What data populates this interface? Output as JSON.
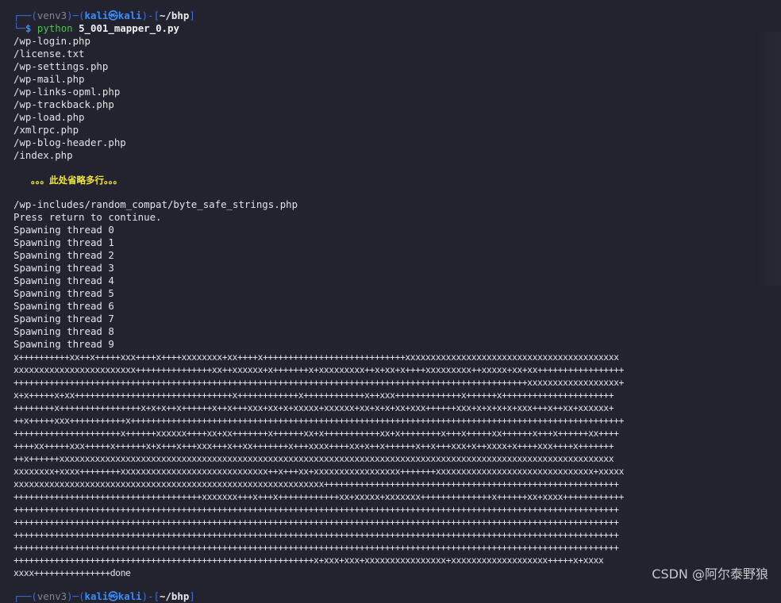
{
  "prompt1": {
    "corner_top": "┌──(",
    "venv": "venv3",
    "mid": ")─(",
    "user": "kali㉿kali",
    "close": ")-[",
    "path": "~/bhp",
    "end": "]",
    "corner_bottom": "└─",
    "dollar": "$",
    "command": "python",
    "arg": "5_001_mapper_0.py"
  },
  "files": [
    "/wp-login.php",
    "/license.txt",
    "/wp-settings.php",
    "/wp-mail.php",
    "/wp-links-opml.php",
    "/wp-trackback.php",
    "/wp-load.php",
    "/xmlrpc.php",
    "/wp-blog-header.php",
    "/index.php"
  ],
  "omitted_note": "。。。此处省略多行。。。",
  "after_lines": [
    "/wp-includes/random_compat/byte_safe_strings.php",
    "Press return to continue.",
    "Spawning thread 0",
    "Spawning thread 1",
    "Spawning thread 2",
    "Spawning thread 3",
    "Spawning thread 4",
    "Spawning thread 5",
    "Spawning thread 6",
    "Spawning thread 7",
    "Spawning thread 8",
    "Spawning thread 9"
  ],
  "progress_lines": [
    "x++++++++++xx++x+++++xxx++++x++++xxxxxxxx+xx++++x++++++++++++++++++++++++++++xxxxxxxxxxxxxxxxxxxxxxxxxxxxxxxxxxxxxxxxxx",
    "xxxxxxxxxxxxxxxxxxxxxxxx+++++++++++++++xx++xxxxxx+x+++++++x+xxxxxxxxx++x+xx+x++++xxxxxxxxx++xxxxx+xx+xx+++++++++++++++++",
    "+++++++++++++++++++++++++++++++++++++++++++++++++++++++++++++++++++++++++++++++++++++++++++++++++++++xxxxxxxxxxxxxxxxxx+",
    "x+x+++++x+xx+++++++++++++++++++++++++++++++x++++++++++++x++++++++++++x++xxx+++++++++++++x++++++x++++++++++++++++++++++",
    "++++++++x++++++++++++++++x+x+x++x++++++x++x+++xxx+xx+x+xxxxx+xxxxxx+xx+x+x+xx+xxx++++++xxx+x+x+x+x+xxx+++x++xx+xxxxxx+",
    "++x+++++xxx+++++++++++x+++++++++++++++++++++++++++++++++++++++++++++++++++++++++++++++++++++++++++++++++++++++++++++++++",
    "+++++++++++++++++++++x++++++xxxxxx++++xx+xx+++++++x++++++xx+x+++++++++++xx+x++++++++x+++x+++++xx++++++x+++x++++++xx++++",
    "++++xx+++++xxx+++++x++++++x+x+++x+++xxx+++x++xx+++++++x+++xxxx++++xx+x++x++++++x++x+++xxx+x++xxxx+x++++xxx++++x+++++++",
    "++x++++++xxxxxxxxxxxxxxxxxxxxxxxxxxxxxxxxxxxxxxxxxxxxxxxxxxxxxxxxxxxxxxxxxxxxxxxxxxxxxxxxxxxxxxxxxxxxxxxxxxxxxxxxxxxxx",
    "xxxxxxxx+xxxx++++++++xxxxxxxxxxxxxxxxxxxxxxxxxxxxx++x+++xx+xxxxxxxxxxxxxxxxx+++++++xxxxxxxxxxxxxxxxxxxxxxxxxxxxxxx+xxxxx",
    "xxxxxxxxxxxxxxxxxxxxxxxxxxxxxxxxxxxxxxxxxxxxxxxxxxxxxxxxxxxxx++++++++++++++++++++++++++++++++++++++++++++++++++++++++++",
    "+++++++++++++++++++++++++++++++++++++xxxxxxx+++x+++x++++++++++++xx+xxxxx+xxxxxxx++++++++++++++x++++++xx+xxxx++++++++++++",
    "+++++++++++++++++++++++++++++++++++++++++++++++++++++++++++++++++++++++++++++++++++++++++++++++++++++++++++++++++++++++",
    "+++++++++++++++++++++++++++++++++++++++++++++++++++++++++++++++++++++++++++++++++++++++++++++++++++++++++++++++++++++++",
    "+++++++++++++++++++++++++++++++++++++++++++++++++++++++++++++++++++++++++++++++++++++++++++++++++++++++++++++++++++++++",
    "+++++++++++++++++++++++++++++++++++++++++++++++++++++++++++++++++++++++++++++++++++++++++++++++++++++++++++++++++++++++",
    "+++++++++++++++++++++++++++++++++++++++++++++++++++++++++++x+xxx+xxx+xxxxxxxxxxxxxxxx+xxxxxxxxxxxxxxxxxxx+++++x+xxxx",
    "xxxx+++++++++++++++done"
  ],
  "prompt2": {
    "corner_top": "┌──(",
    "venv": "venv3",
    "mid": ")─(",
    "user": "kali㉿kali",
    "close": ")-[",
    "path": "~/bhp",
    "end": "]"
  },
  "watermark": "CSDN @阿尔泰野狼",
  "colors": {
    "background": "#23232f",
    "prompt_blue": "#3a8dff",
    "command_green": "#4cc24c",
    "note_yellow": "#f2e53a"
  }
}
